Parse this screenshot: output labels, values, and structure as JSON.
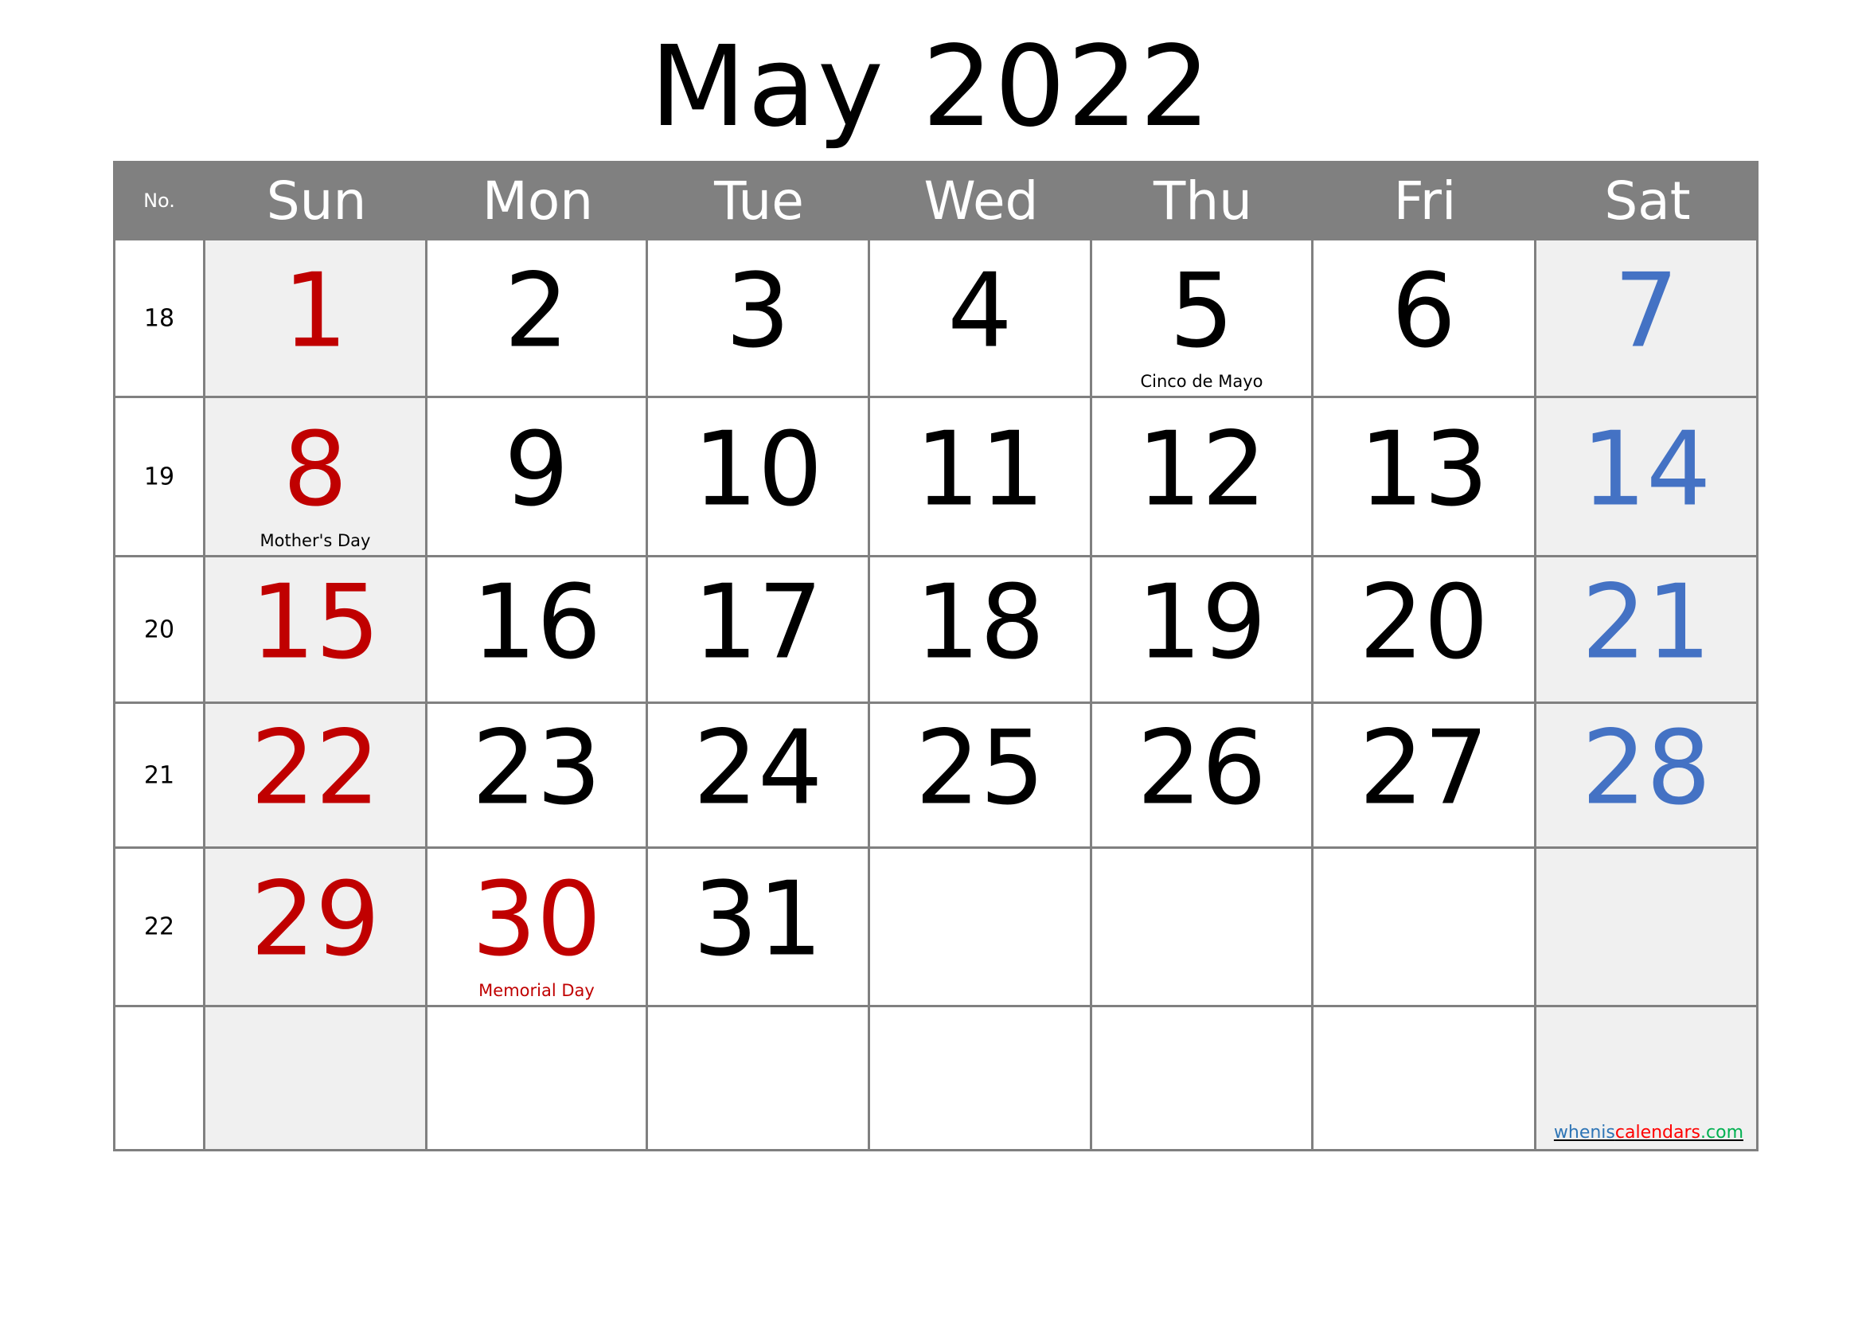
{
  "title": "May 2022",
  "header": {
    "week_label": "No.",
    "days": [
      "Sun",
      "Mon",
      "Tue",
      "Wed",
      "Thu",
      "Fri",
      "Sat"
    ]
  },
  "colors": {
    "header_bg": "#808080",
    "sunday_red": "#c00000",
    "saturday_blue": "#4472c4",
    "weekend_fill": "#f0f0f0",
    "grid_line": "#808080"
  },
  "weeks": [
    {
      "number": "18",
      "days": [
        {
          "day": "1"
        },
        {
          "day": "2"
        },
        {
          "day": "3"
        },
        {
          "day": "4"
        },
        {
          "day": "5",
          "note": "Cinco de Mayo"
        },
        {
          "day": "6"
        },
        {
          "day": "7"
        }
      ]
    },
    {
      "number": "19",
      "days": [
        {
          "day": "8",
          "note": "Mother's Day"
        },
        {
          "day": "9"
        },
        {
          "day": "10"
        },
        {
          "day": "11"
        },
        {
          "day": "12"
        },
        {
          "day": "13"
        },
        {
          "day": "14"
        }
      ]
    },
    {
      "number": "20",
      "days": [
        {
          "day": "15"
        },
        {
          "day": "16"
        },
        {
          "day": "17"
        },
        {
          "day": "18"
        },
        {
          "day": "19"
        },
        {
          "day": "20"
        },
        {
          "day": "21"
        }
      ]
    },
    {
      "number": "21",
      "days": [
        {
          "day": "22"
        },
        {
          "day": "23"
        },
        {
          "day": "24"
        },
        {
          "day": "25"
        },
        {
          "day": "26"
        },
        {
          "day": "27"
        },
        {
          "day": "28"
        }
      ]
    },
    {
      "number": "22",
      "days": [
        {
          "day": "29"
        },
        {
          "day": "30",
          "note": "Memorial Day",
          "holiday": true
        },
        {
          "day": "31"
        },
        {
          "day": ""
        },
        {
          "day": ""
        },
        {
          "day": ""
        },
        {
          "day": ""
        }
      ]
    },
    {
      "number": "",
      "days": [
        {
          "day": ""
        },
        {
          "day": ""
        },
        {
          "day": ""
        },
        {
          "day": ""
        },
        {
          "day": ""
        },
        {
          "day": ""
        },
        {
          "day": ""
        }
      ]
    }
  ],
  "watermark": {
    "part1": "whenis",
    "part2": "calendars",
    "part3": ".com"
  }
}
